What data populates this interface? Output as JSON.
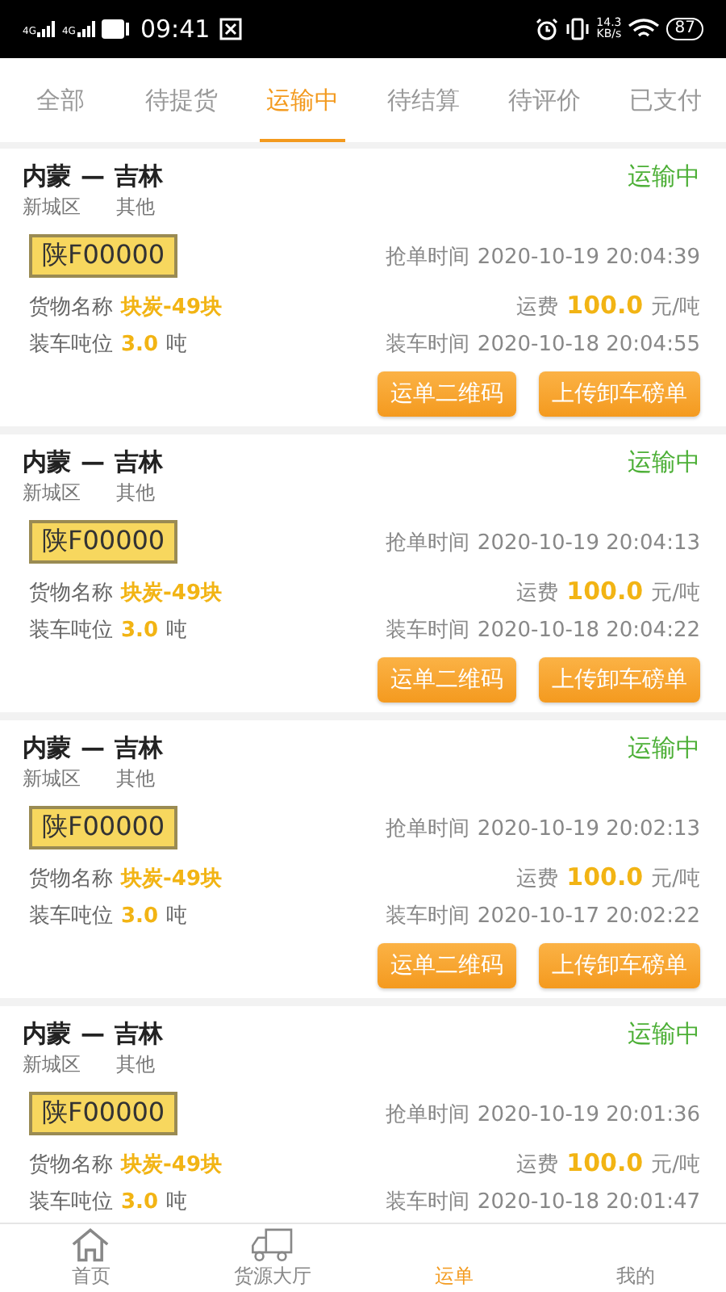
{
  "status_bar": {
    "network_labels": [
      "4G",
      "4G"
    ],
    "time": "09:41",
    "net_speed": "14.3",
    "net_speed_unit": "KB/s",
    "battery": "87"
  },
  "tabs": [
    {
      "label": "全部",
      "selected": false
    },
    {
      "label": "待提货",
      "selected": false
    },
    {
      "label": "运输中",
      "selected": true
    },
    {
      "label": "待结算",
      "selected": false
    },
    {
      "label": "待评价",
      "selected": false
    },
    {
      "label": "已支付",
      "selected": false
    }
  ],
  "orders": [
    {
      "route_from": "内蒙",
      "route_sep": "—",
      "route_to": "吉林",
      "district": "新城区",
      "category": "其他",
      "status": "运输中",
      "plate": "陕F00000",
      "grab_label": "抢单时间",
      "grab_time": "2020-10-19 20:04:39",
      "cargo_label": "货物名称",
      "cargo": "块炭-49块",
      "fee_label": "运费",
      "fee": "100.0",
      "fee_unit": "元/吨",
      "tonnage_label": "装车吨位",
      "tonnage": "3.0",
      "tonnage_unit": "吨",
      "load_label": "装车时间",
      "load_time": "2020-10-18 20:04:55",
      "buttons": [
        "运单二维码",
        "上传卸车磅单"
      ]
    },
    {
      "route_from": "内蒙",
      "route_sep": "—",
      "route_to": "吉林",
      "district": "新城区",
      "category": "其他",
      "status": "运输中",
      "plate": "陕F00000",
      "grab_label": "抢单时间",
      "grab_time": "2020-10-19 20:04:13",
      "cargo_label": "货物名称",
      "cargo": "块炭-49块",
      "fee_label": "运费",
      "fee": "100.0",
      "fee_unit": "元/吨",
      "tonnage_label": "装车吨位",
      "tonnage": "3.0",
      "tonnage_unit": "吨",
      "load_label": "装车时间",
      "load_time": "2020-10-18 20:04:22",
      "buttons": [
        "运单二维码",
        "上传卸车磅单"
      ]
    },
    {
      "route_from": "内蒙",
      "route_sep": "—",
      "route_to": "吉林",
      "district": "新城区",
      "category": "其他",
      "status": "运输中",
      "plate": "陕F00000",
      "grab_label": "抢单时间",
      "grab_time": "2020-10-19 20:02:13",
      "cargo_label": "货物名称",
      "cargo": "块炭-49块",
      "fee_label": "运费",
      "fee": "100.0",
      "fee_unit": "元/吨",
      "tonnage_label": "装车吨位",
      "tonnage": "3.0",
      "tonnage_unit": "吨",
      "load_label": "装车时间",
      "load_time": "2020-10-17 20:02:22",
      "buttons": [
        "运单二维码",
        "上传卸车磅单"
      ]
    },
    {
      "route_from": "内蒙",
      "route_sep": "—",
      "route_to": "吉林",
      "district": "新城区",
      "category": "其他",
      "status": "运输中",
      "plate": "陕F00000",
      "grab_label": "抢单时间",
      "grab_time": "2020-10-19 20:01:36",
      "cargo_label": "货物名称",
      "cargo": "块炭-49块",
      "fee_label": "运费",
      "fee": "100.0",
      "fee_unit": "元/吨",
      "tonnage_label": "装车吨位",
      "tonnage": "3.0",
      "tonnage_unit": "吨",
      "load_label": "装车时间",
      "load_time": "2020-10-18 20:01:47"
    }
  ],
  "bottom_nav": [
    {
      "label": "首页",
      "selected": false
    },
    {
      "label": "货源大厅",
      "selected": false
    },
    {
      "label": "运单",
      "selected": true
    },
    {
      "label": "我的",
      "selected": false
    }
  ]
}
